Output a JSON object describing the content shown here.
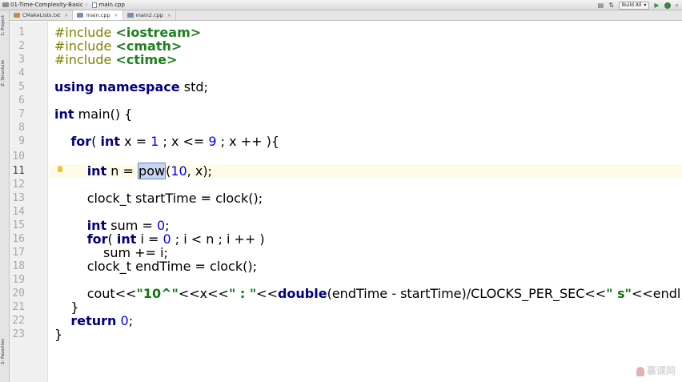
{
  "navbar": {
    "project": "01-Time-Complexity-Basic",
    "file": "main.cpp",
    "build_config": "Build All"
  },
  "tabs": [
    {
      "label": "CMakeLists.txt",
      "active": false
    },
    {
      "label": "main.cpp",
      "active": true
    },
    {
      "label": "main2.cpp",
      "active": false
    }
  ],
  "toolstrip": {
    "project": "1: Project",
    "structure": "Z: Structure",
    "favorites": "2: Favorites"
  },
  "editor": {
    "current_line": 11,
    "line_numbers": [
      "1",
      "2",
      "3",
      "4",
      "5",
      "6",
      "7",
      "8",
      "9",
      "10",
      "11",
      "12",
      "13",
      "14",
      "15",
      "16",
      "17",
      "18",
      "19",
      "20",
      "21",
      "22",
      "23"
    ],
    "lines": {
      "l1a": "#include ",
      "l1b": "<iostream>",
      "l2a": "#include ",
      "l2b": "<cmath>",
      "l3a": "#include ",
      "l3b": "<ctime>",
      "l5a": "using namespace",
      "l5b": " std;",
      "l7a": "int",
      "l7b": " main() {",
      "l9a": "    ",
      "l9b": "for",
      "l9c": "( ",
      "l9d": "int",
      "l9e": " x = ",
      "l9f": "1",
      "l9g": " ; x <= ",
      "l9h": "9",
      "l9i": " ; x ++ ){",
      "l11a": "        ",
      "l11b": "int",
      "l11c": " n = ",
      "l11d": "pow",
      "l11e": "(",
      "l11f": "10",
      "l11g": ", x);",
      "l13": "        clock_t startTime = clock();",
      "l15a": "        ",
      "l15b": "int",
      "l15c": " sum = ",
      "l15d": "0",
      "l15e": ";",
      "l16a": "        ",
      "l16b": "for",
      "l16c": "( ",
      "l16d": "int",
      "l16e": " i = ",
      "l16f": "0",
      "l16g": " ; i < n ; i ++ )",
      "l17": "            sum += i;",
      "l18": "        clock_t endTime = clock();",
      "l20a": "        cout<<",
      "l20b": "\"10^\"",
      "l20c": "<<x<<",
      "l20d": "\" : \"",
      "l20e": "<<",
      "l20f": "double",
      "l20g": "(endTime - startTime)/CLOCKS_PER_SEC<<",
      "l20h": "\" s\"",
      "l20i": "<<endl;",
      "l21": "    }",
      "l22a": "    ",
      "l22b": "return",
      "l22c": " ",
      "l22d": "0",
      "l22e": ";",
      "l23": "}"
    }
  },
  "watermark": "慕课网"
}
